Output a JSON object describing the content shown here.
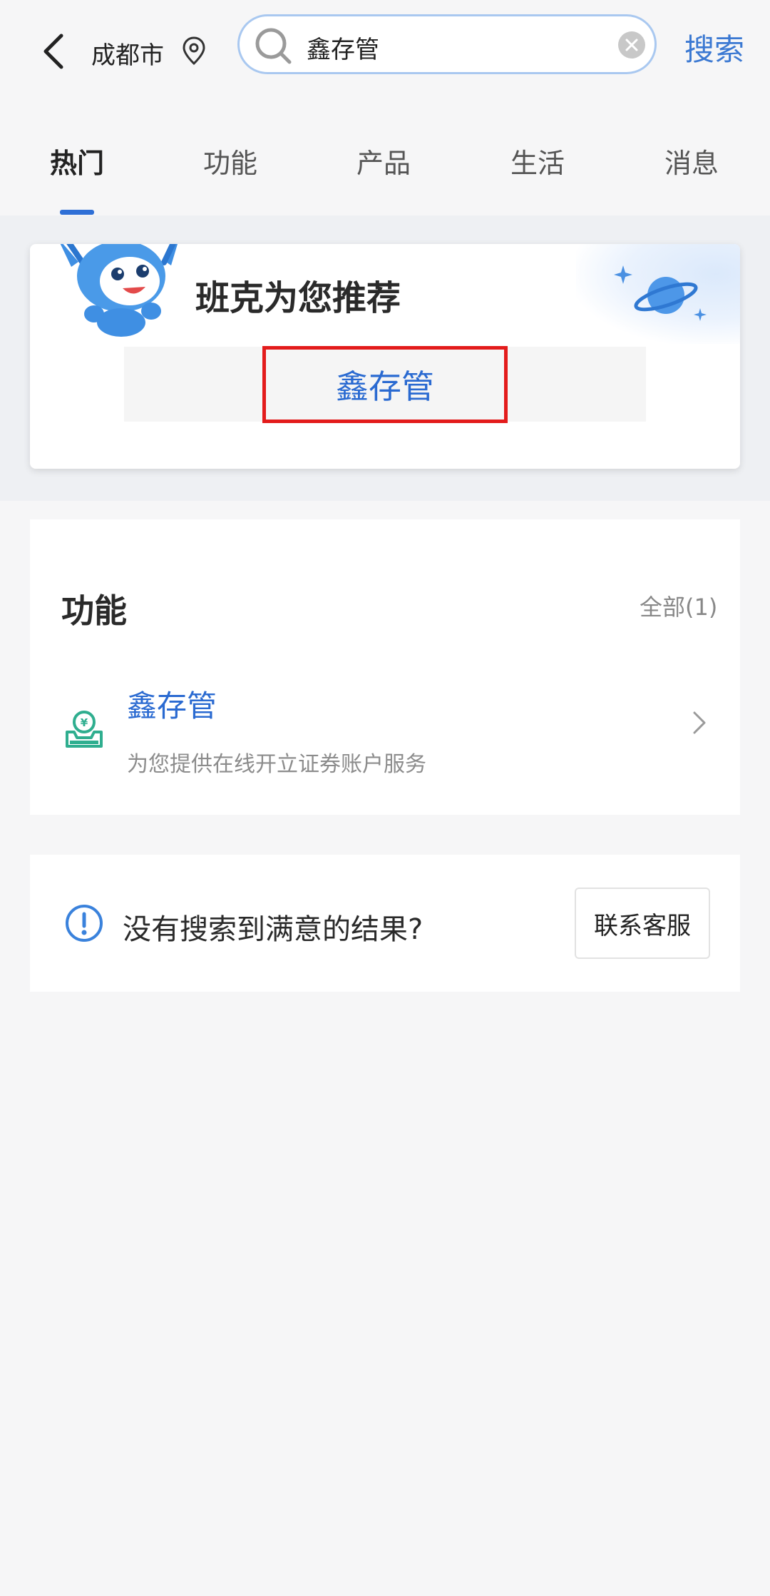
{
  "header": {
    "city": "成都市",
    "search_value": "鑫存管",
    "search_button": "搜索"
  },
  "tabs": [
    {
      "label": "热门",
      "active": true
    },
    {
      "label": "功能",
      "active": false
    },
    {
      "label": "产品",
      "active": false
    },
    {
      "label": "生活",
      "active": false
    },
    {
      "label": "消息",
      "active": false
    }
  ],
  "recommendation": {
    "title": "班克为您推荐",
    "item": "鑫存管"
  },
  "function_section": {
    "title": "功能",
    "all_label": "全部(1)",
    "item": {
      "name": "鑫存管",
      "description": "为您提供在线开立证券账户服务",
      "icon": "yuan-deposit-icon"
    }
  },
  "feedback": {
    "text": "没有搜索到满意的结果?",
    "button": "联系客服"
  },
  "colors": {
    "accent": "#2e6fd6",
    "link": "#2a6ad1",
    "highlight_border": "#e31b1b",
    "icon_green": "#2fae8f"
  }
}
